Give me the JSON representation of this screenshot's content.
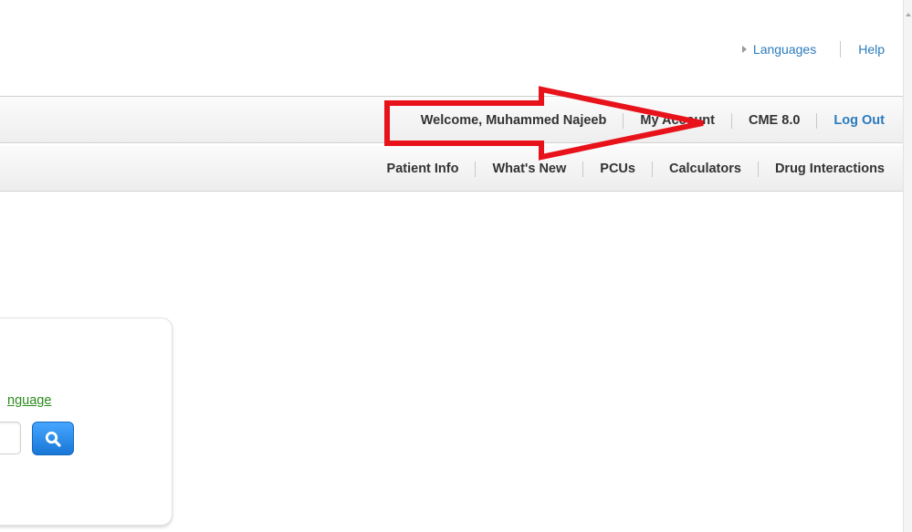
{
  "utility_links": {
    "languages": "Languages",
    "help": "Help"
  },
  "account_bar": {
    "welcome": "Welcome, Mu",
    "user_name": "hammed Najeeb",
    "my_account": "My Account",
    "cme": "CME 8.0",
    "logout": "Log Out"
  },
  "nav": {
    "items": [
      "Patient Info",
      "What's New",
      "PCUs",
      "Calculators",
      "Drug Interactions"
    ]
  },
  "card": {
    "language_link": "nguage"
  },
  "colors": {
    "link_blue": "#2b7bbd",
    "link_green": "#2d8a1e",
    "annotation_red": "#e8121b",
    "search_button": "#1f84e8"
  },
  "icons": {
    "languages_marker": "triangle-right-icon",
    "search": "search-icon",
    "annotation": "red-arrow-annotation"
  }
}
